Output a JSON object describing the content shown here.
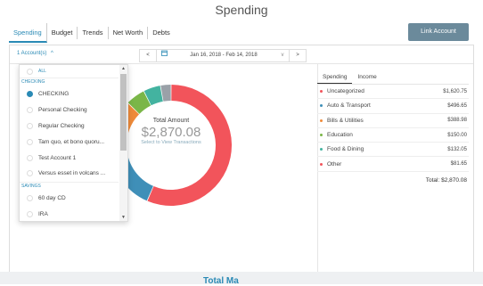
{
  "page": {
    "title": "Spending"
  },
  "tabs": [
    "Spending",
    "Budget",
    "Trends",
    "Net Worth",
    "Debts"
  ],
  "link_account_label": "Link Account",
  "toolbar": {
    "accounts_label": "1 Account(s)",
    "chevron": "^",
    "prev": "<",
    "next": ">",
    "date_range": "Jan 16, 2018 - Feb 14, 2018",
    "calendar_icon": "calendar-icon",
    "dropdown_caret": "v"
  },
  "donut": {
    "center_label": "Total Amount",
    "center_amount": "$2,870.08",
    "center_hint": "Select to View Transactions"
  },
  "chart_data": {
    "type": "pie",
    "labels": [
      "Uncategorized",
      "Auto & Transport",
      "Bills & Utilities",
      "Education",
      "Food & Dining",
      "Other"
    ],
    "values": [
      1620.75,
      496.65,
      388.98,
      150.0,
      132.05,
      81.65
    ],
    "colors": [
      "#f2545b",
      "#3f8fb8",
      "#ef8b3a",
      "#7ab648",
      "#43b3a0",
      "#9aa1a8"
    ],
    "title": "",
    "total": 2870.08
  },
  "side_panel": {
    "tabs": [
      "Spending",
      "Income"
    ],
    "categories": [
      {
        "name": "Uncategorized",
        "amount": "$1,620.75",
        "color": "#f2545b"
      },
      {
        "name": "Auto & Transport",
        "amount": "$496.65",
        "color": "#3f8fb8"
      },
      {
        "name": "Bills & Utilities",
        "amount": "$388.98",
        "color": "#ef8b3a"
      },
      {
        "name": "Education",
        "amount": "$150.00",
        "color": "#7ab648"
      },
      {
        "name": "Food & Dining",
        "amount": "$132.05",
        "color": "#43b3a0"
      },
      {
        "name": "Other",
        "amount": "$81.65",
        "color": "#f2545b"
      }
    ],
    "total_label": "Total: $2,870.08"
  },
  "accounts_dropdown": {
    "all_label": "ALL",
    "section_checking": "CHECKING",
    "items": [
      {
        "label": "CHECKING",
        "checked": true
      },
      {
        "label": "Personal Checking",
        "checked": false
      },
      {
        "label": "Regular Checking",
        "checked": false
      },
      {
        "label": "Tam quo, et bono quoru...",
        "checked": false
      },
      {
        "label": "Test Account 1",
        "checked": false
      },
      {
        "label": "Versus esset in volcans ...",
        "checked": false
      }
    ],
    "section_savings": "SAVINGS",
    "savings_items": [
      {
        "label": "60 day CD",
        "checked": false
      },
      {
        "label": "IRA",
        "checked": false
      }
    ],
    "scroll_up": "▲",
    "scroll_down": "▼"
  },
  "footer": {
    "partial_text": "Total Ma"
  }
}
